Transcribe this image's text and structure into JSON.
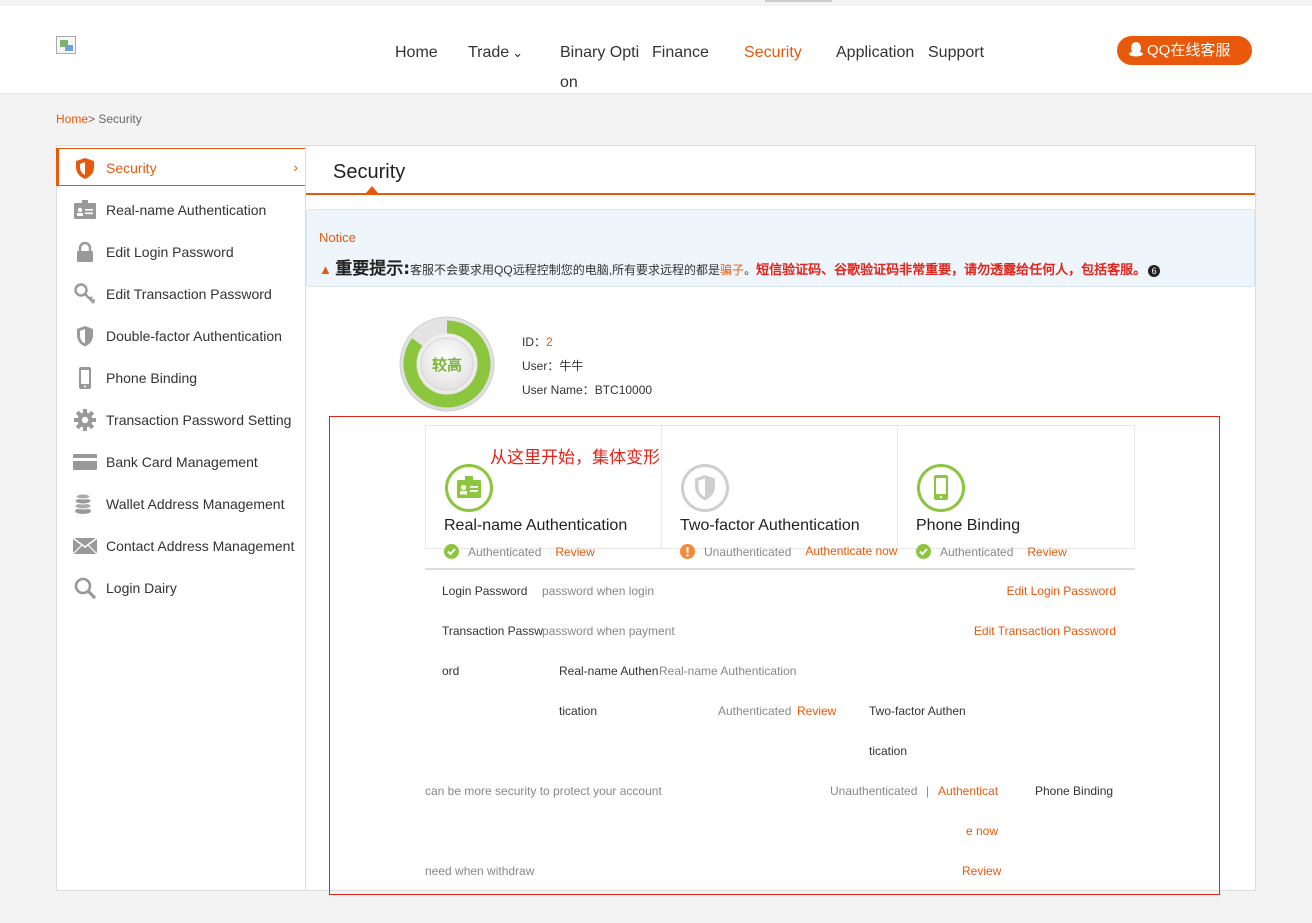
{
  "nav": {
    "home": "Home",
    "trade": "Trade",
    "trade_caret": "⌄",
    "binary_option": "Binary Option",
    "finance": "Finance",
    "security": "Security",
    "application": "Application",
    "support": "Support",
    "qq_service": "QQ在线客服"
  },
  "breadcrumb": {
    "home": "Home",
    "sep": ">",
    "current": "Security"
  },
  "sidebar": {
    "items": [
      {
        "label": "Security",
        "icon": "shield-icon"
      },
      {
        "label": "Real-name Authentication",
        "icon": "id-card-icon"
      },
      {
        "label": "Edit Login Password",
        "icon": "lock-icon"
      },
      {
        "label": "Edit Transaction Password",
        "icon": "key-icon"
      },
      {
        "label": "Double-factor Authentication",
        "icon": "shield-outline-icon"
      },
      {
        "label": "Phone Binding",
        "icon": "phone-icon"
      },
      {
        "label": "Transaction Password Setting",
        "icon": "gear-icon"
      },
      {
        "label": "Bank Card Management",
        "icon": "card-icon"
      },
      {
        "label": "Wallet Address Management",
        "icon": "coins-icon"
      },
      {
        "label": "Contact Address Management",
        "icon": "envelope-icon"
      },
      {
        "label": "Login Dairy",
        "icon": "magnifier-icon"
      }
    ],
    "active_chevron": "›"
  },
  "main": {
    "title": "Security",
    "notice": {
      "title": "Notice",
      "warn_symbol": "▲",
      "heading": "重要提示:",
      "text1": "客服不会要求用QQ远程控制您的电脑,所有要求远程的都是",
      "scam": "骗子",
      "sep": "。",
      "emphasis": "短信验证码、谷歌验证码非常重要，请勿透露给任何人，包括客服。",
      "num": "6"
    },
    "gauge": {
      "label": "较高",
      "level": 0.85
    },
    "user": {
      "id_label": "ID：",
      "id_value": "2",
      "user_label": "User：",
      "user_value": "牛牛",
      "username_label": "User Name：",
      "username_value": "BTC10000"
    },
    "annotation": "从这里开始，集体变形",
    "cards": [
      {
        "title": "Real-name Authentication",
        "status": "Authenticated",
        "action": "Review",
        "state": "ok",
        "icon": "id-card-icon"
      },
      {
        "title": "Two-factor Authentication",
        "status": "Unauthenticated",
        "action": "Authenticate now",
        "state": "warn",
        "icon": "shield-outline-icon"
      },
      {
        "title": "Phone Binding",
        "status": "Authenticated",
        "action": "Review",
        "state": "ok",
        "icon": "phone-icon"
      }
    ],
    "rows": {
      "login_password": "Login Password",
      "login_desc": "password when login",
      "edit_login": "Edit Login Password",
      "transaction_password_a": "Transaction Passw",
      "transaction_password_b": "ord",
      "transaction_desc": "password when payment",
      "edit_transaction": "Edit Transaction Password",
      "realname_a": "Real-name Authen",
      "realname_b": "tication",
      "realname_desc": "Real-name Authentication",
      "realname_status": "Authenticated",
      "realname_action": "Review",
      "twofactor_a": "Two-factor Authen",
      "twofactor_b": "tication",
      "twofactor_desc": "can be more security to protect your account",
      "twofactor_status": "Unauthenticated",
      "twofactor_sep": "|",
      "twofactor_action_a": "Authenticat",
      "twofactor_action_b": "e now",
      "phone": "Phone Binding",
      "phone_desc": "need when withdraw",
      "phone_action": "Review"
    }
  },
  "colors": {
    "accent": "#e8590c",
    "green": "#8cc63f",
    "warn": "#f08a3c",
    "annotation": "#e1251b"
  }
}
